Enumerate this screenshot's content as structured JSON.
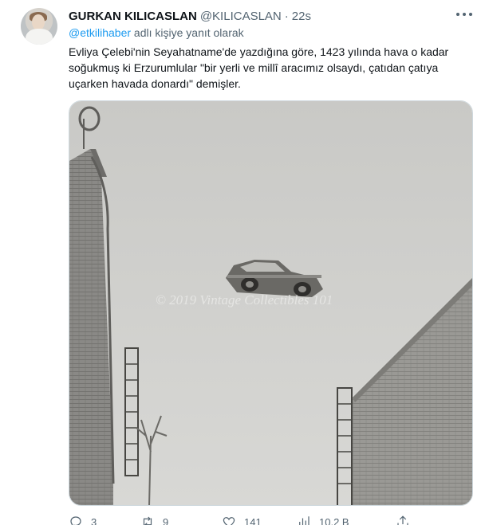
{
  "tweet": {
    "display_name": "GURKAN KILICASLAN",
    "handle": "@KILICASLAN",
    "separator": "·",
    "time": "22s",
    "reply_mention": "@etkilihaber",
    "reply_suffix": " adlı kişiye yanıt olarak",
    "text": "Evliya Çelebi'nin Seyahatname'de yazdığına göre, 1423 yılında hava o kadar soğukmuş ki Erzurumlular \"bir yerli ve millî aracımız olsaydı, çatıdan çatıya uçarken havada donardı\" demişler.",
    "image_watermark": "© 2019 Vintage Collectibles 101"
  },
  "actions": {
    "reply": {
      "icon": "reply-icon",
      "count": "3"
    },
    "retweet": {
      "icon": "retweet-icon",
      "count": "9"
    },
    "like": {
      "icon": "heart-icon",
      "count": "141"
    },
    "views": {
      "icon": "views-icon",
      "count": "10,2 B"
    },
    "share": {
      "icon": "share-icon"
    }
  },
  "colors": {
    "text": "#0f1419",
    "secondary": "#536471",
    "link": "#1d9bf0",
    "border": "#cfd9de"
  }
}
